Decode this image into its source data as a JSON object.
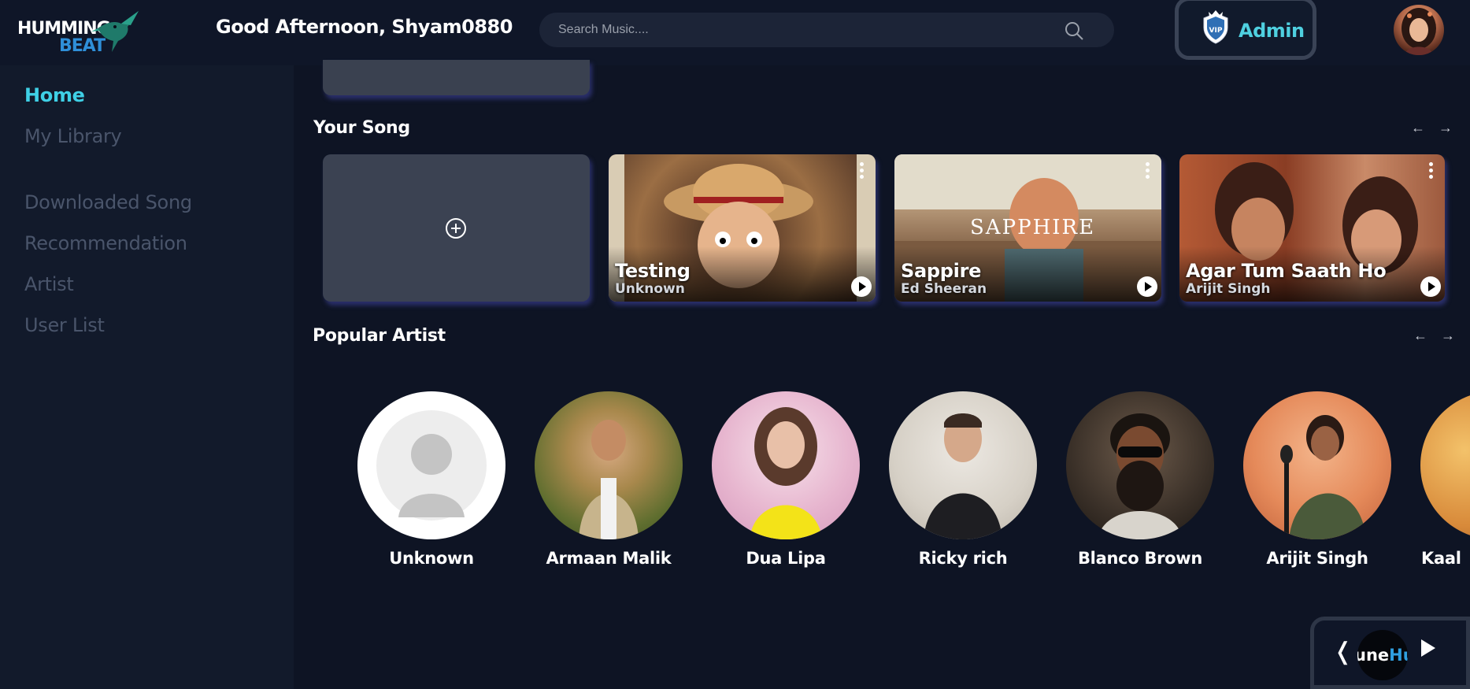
{
  "header": {
    "logo_top": "HUMMING",
    "logo_bottom": "BEAT",
    "greeting": "Good Afternoon, Shyam0880",
    "search_placeholder": "Search Music....",
    "admin_label": "Admin"
  },
  "sidebar": {
    "items": [
      {
        "label": "Home",
        "active": true
      },
      {
        "label": "My Library"
      },
      {
        "label": "Downloaded Song"
      },
      {
        "label": "Recommendation"
      },
      {
        "label": "Artist"
      },
      {
        "label": "User List"
      }
    ]
  },
  "sections": {
    "your_song": "Your Song",
    "popular_artist": "Popular Artist",
    "arrows": "← →"
  },
  "songs": [
    {
      "title": "Testing",
      "artist": "Unknown"
    },
    {
      "title": "Sappire",
      "artist": "Ed Sheeran",
      "overlay_text": "SAPPHIRE"
    },
    {
      "title": "Agar Tum Saath Ho",
      "artist": "Arijit Singh"
    }
  ],
  "artists": [
    {
      "name": "Unknown"
    },
    {
      "name": "Armaan Malik"
    },
    {
      "name": "Dua Lipa"
    },
    {
      "name": "Ricky rich"
    },
    {
      "name": "Blanco Brown"
    },
    {
      "name": "Arijit Singh"
    },
    {
      "name": "Kaal"
    }
  ],
  "player": {
    "prev_symbol": "❬",
    "marquee_a": "une",
    "marquee_b": "Hu"
  },
  "colors": {
    "accent": "#3fd0e6",
    "background": "#0e1424",
    "sidebar": "#121a2b"
  }
}
